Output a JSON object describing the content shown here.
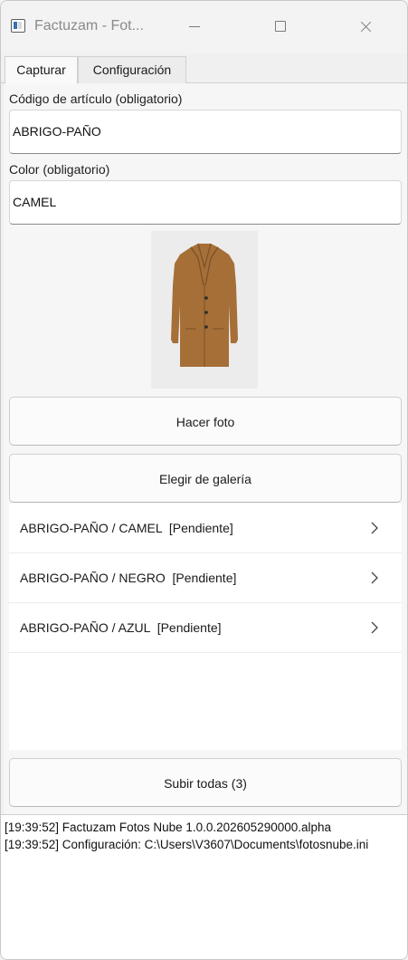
{
  "window": {
    "title": "Factuzam - Fot...",
    "icons": {
      "app": "app-window-icon",
      "minimize": "minimize-icon",
      "maximize": "maximize-icon",
      "close": "close-icon"
    }
  },
  "tabs": [
    {
      "label": "Capturar",
      "active": true
    },
    {
      "label": "Configuración",
      "active": false
    }
  ],
  "form": {
    "article_label": "Código de artículo (obligatorio)",
    "article_value": "ABRIGO-PAÑO",
    "color_label": "Color (obligatorio)",
    "color_value": "CAMEL"
  },
  "photo": {
    "description": "coat-photo",
    "coat_color": "#a66f38"
  },
  "buttons": {
    "take_photo": "Hacer foto",
    "choose_gallery": "Elegir de galería",
    "upload_all": "Subir todas (3)"
  },
  "items": [
    {
      "label": "ABRIGO-PAÑO / CAMEL  [Pendiente]"
    },
    {
      "label": "ABRIGO-PAÑO / NEGRO  [Pendiente]"
    },
    {
      "label": "ABRIGO-PAÑO / AZUL  [Pendiente]"
    }
  ],
  "log": [
    "[19:39:52] Factuzam Fotos Nube 1.0.0.202605290000.alpha",
    "[19:39:52] Configuración: C:\\Users\\V3607\\Documents\\fotosnube.ini"
  ]
}
